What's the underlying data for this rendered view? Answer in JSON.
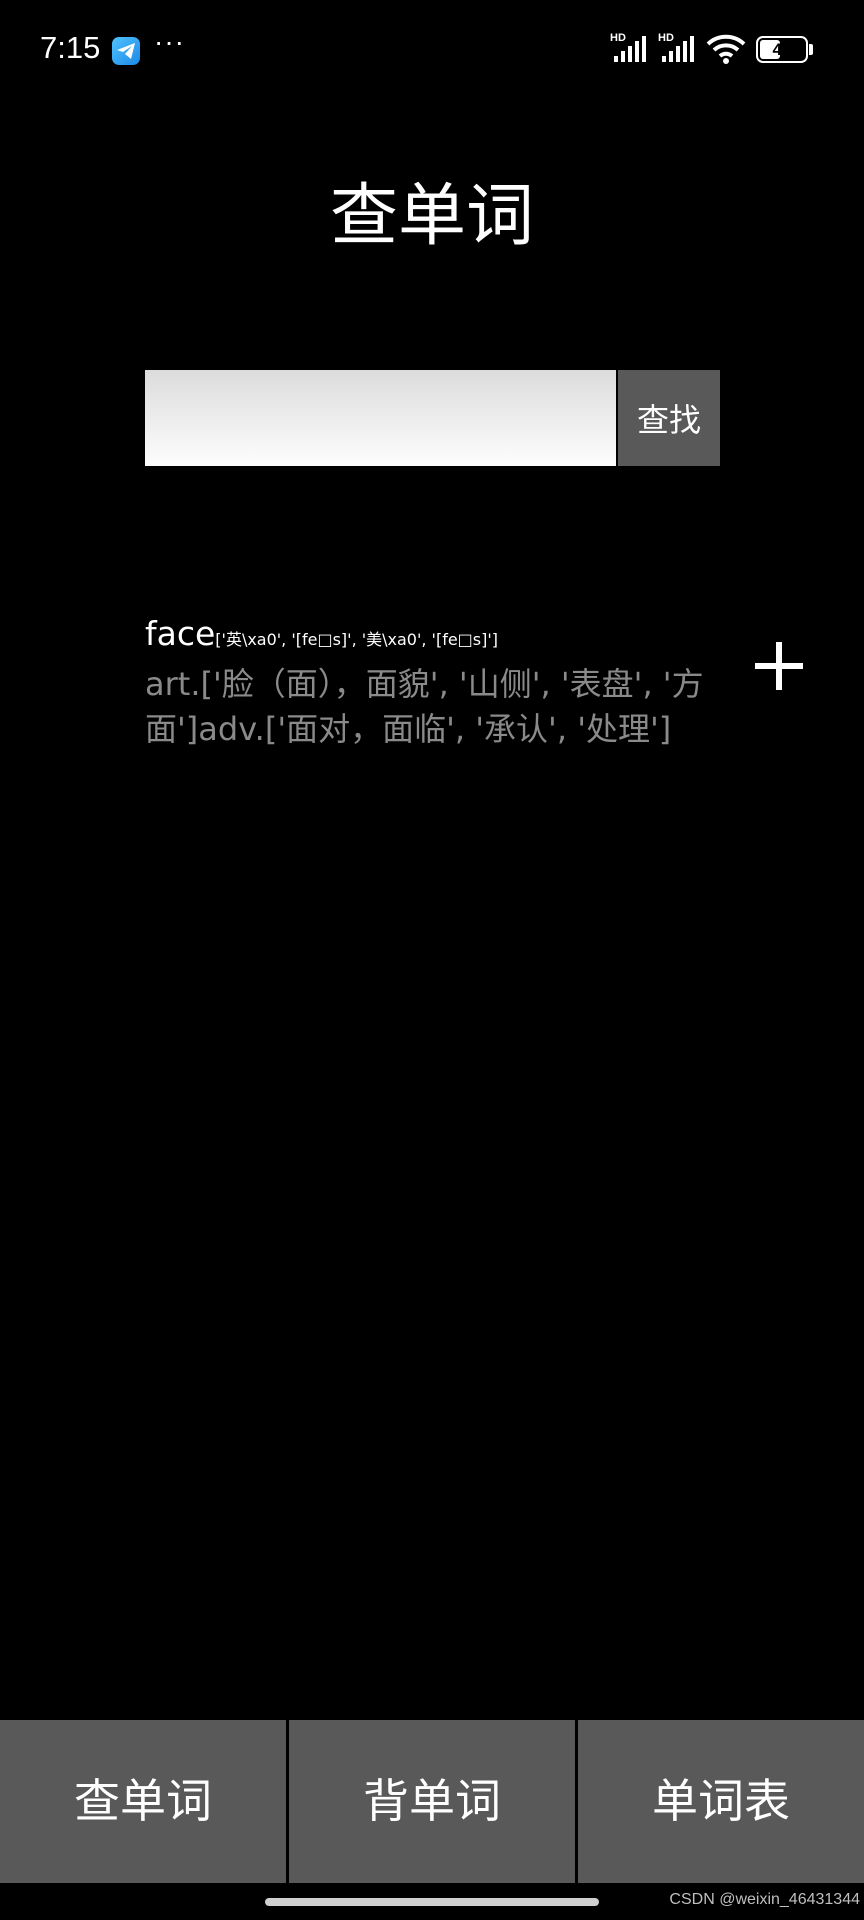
{
  "status_bar": {
    "time": "7:15",
    "more_icon": "···",
    "signal_1_label": "HD",
    "signal_2_label": "HD",
    "battery_level": "46",
    "battery_fraction": 0.46,
    "app_icon": "telegram-send-icon"
  },
  "header": {
    "title": "查单词"
  },
  "search": {
    "placeholder": "",
    "value": "",
    "button_label": "查找"
  },
  "result": {
    "word": "face",
    "phonetic": "['英\\xa0', '[fe□s]', '美\\xa0', '[fe□s]']",
    "meaning": "art.['脸（面），面貌', '山侧', '表盘', '方面']adv.['面对，面临', '承认', '处理']",
    "add_icon": "plus-icon"
  },
  "bottom_nav": {
    "tabs": [
      {
        "label": "查单词"
      },
      {
        "label": "背单词"
      },
      {
        "label": "单词表"
      }
    ]
  },
  "watermark": "CSDN @weixin_46431344",
  "colors": {
    "background": "#000000",
    "tab_background": "#595959",
    "meaning_text": "#8a8a8a"
  }
}
